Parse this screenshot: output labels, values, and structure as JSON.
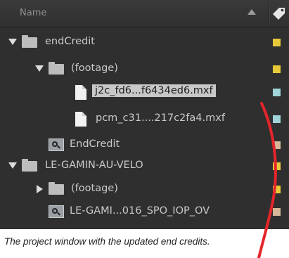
{
  "header": {
    "column_name": "Name"
  },
  "rows": [
    {
      "label": "endCredit",
      "swatch": "#e8c93a"
    },
    {
      "label": "(footage)",
      "swatch": "#e8c93a"
    },
    {
      "label": "j2c_fd6...f6434ed6.mxf",
      "swatch": "#9fd4d9",
      "selected": true
    },
    {
      "label": "pcm_c31....217c2fa4.mxf",
      "swatch": "#9fd4d9"
    },
    {
      "label": "EndCredit",
      "swatch": "#d6b89a"
    },
    {
      "label": "LE-GAMIN-AU-VELO",
      "swatch": "#e8c93a"
    },
    {
      "label": "(footage)",
      "swatch": "#e8c93a"
    },
    {
      "label": "LE-GAMI...016_SPO_IOP_OV",
      "swatch": "#d6b89a"
    }
  ],
  "caption": "The project window with the updated end credits.",
  "colors": {
    "panel": "#2f2f2f",
    "selection": "#c8c8c8",
    "annotation_line": "#e3262b"
  }
}
